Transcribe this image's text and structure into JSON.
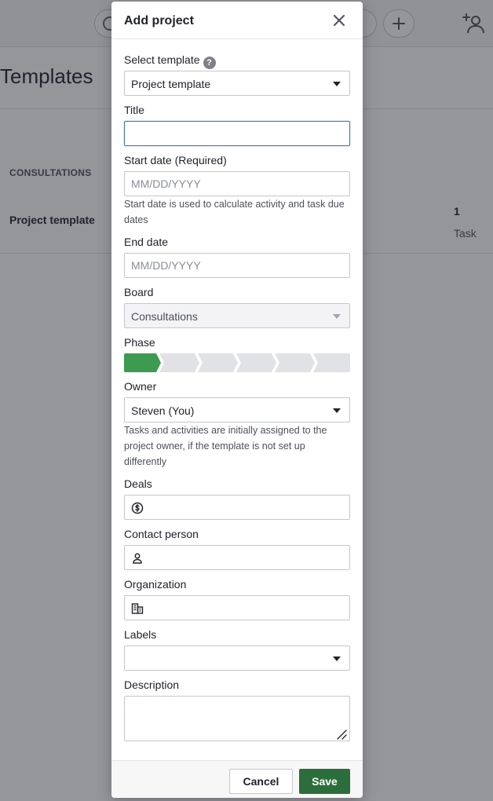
{
  "background": {
    "heading": "Templates",
    "section_label": "CONSULTATIONS",
    "row": {
      "title": "Project template",
      "count": "1",
      "count_label": "Task"
    }
  },
  "modal": {
    "title": "Add project",
    "fields": {
      "template": {
        "label": "Select template",
        "help": "?",
        "value": "Project template"
      },
      "title": {
        "label": "Title",
        "value": "",
        "placeholder": ""
      },
      "start_date": {
        "label": "Start date (Required)",
        "placeholder": "MM/DD/YYYY",
        "hint": "Start date is used to calculate activity and task due dates"
      },
      "end_date": {
        "label": "End date",
        "placeholder": "MM/DD/YYYY"
      },
      "board": {
        "label": "Board",
        "value": "Consultations"
      },
      "phase": {
        "label": "Phase",
        "total": 6,
        "active": 1
      },
      "owner": {
        "label": "Owner",
        "value": "Steven (You)",
        "hint": "Tasks and activities are initially assigned to the project owner, if the template is not set up differently"
      },
      "deals": {
        "label": "Deals",
        "icon": "dollar-circle-icon"
      },
      "contact": {
        "label": "Contact person",
        "icon": "person-icon"
      },
      "organization": {
        "label": "Organization",
        "icon": "building-icon"
      },
      "labels": {
        "label": "Labels",
        "value": ""
      },
      "description": {
        "label": "Description"
      }
    },
    "buttons": {
      "cancel": "Cancel",
      "save": "Save"
    }
  },
  "colors": {
    "accent": "#2c6e3b",
    "phase_active": "#3d9a50",
    "phase_inactive": "#e1e2e6",
    "focus": "#3c7bae"
  }
}
